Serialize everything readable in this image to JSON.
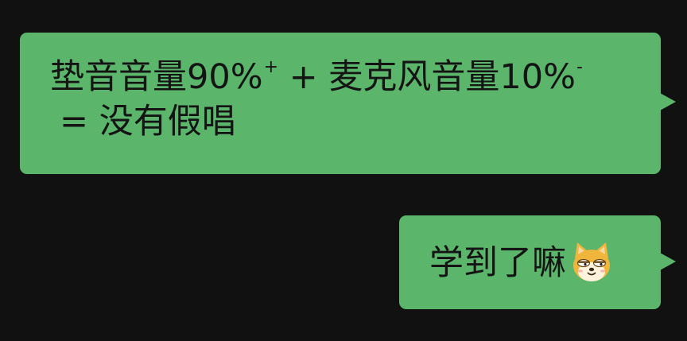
{
  "conversation": {
    "messages": [
      {
        "sender": "self",
        "line1": "垫音音量90%",
        "sup_plus": "+",
        "mid": " + 麦克风音量10%",
        "sup_minus": "-",
        "line2": "= 没有假唱"
      },
      {
        "sender": "self",
        "text": "学到了嘛",
        "emoji": "doge-emoji"
      }
    ]
  },
  "colors": {
    "background": "#111111",
    "bubble": "#5BB56A",
    "text": "#141414"
  }
}
